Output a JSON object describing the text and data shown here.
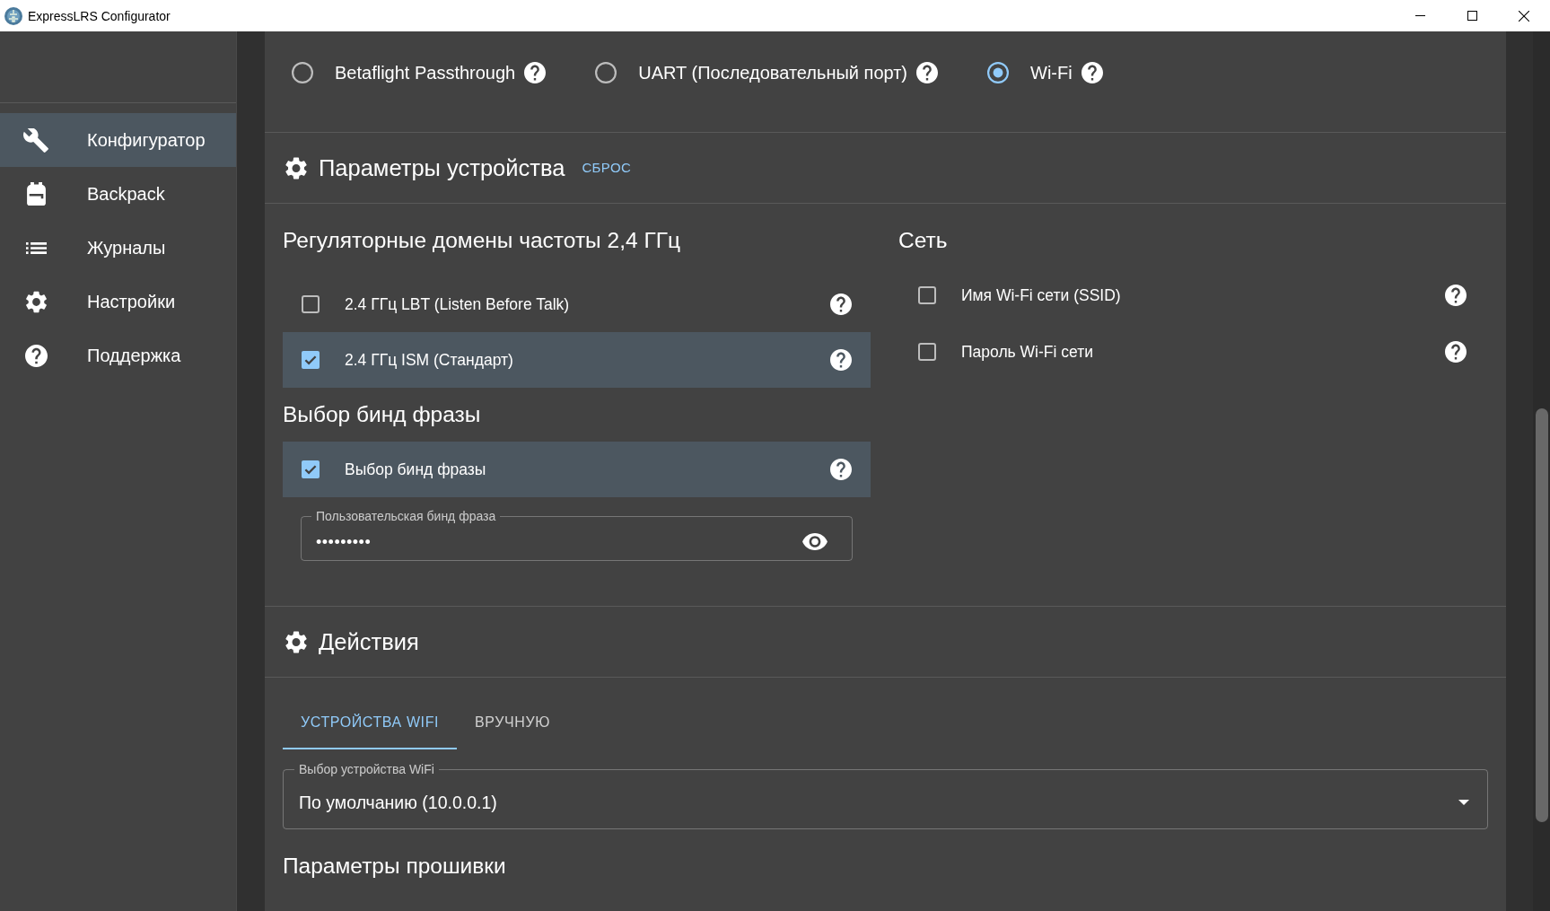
{
  "window": {
    "title": "ExpressLRS Configurator"
  },
  "sidebar": {
    "items": [
      {
        "label": "Конфигуратор",
        "selected": true
      },
      {
        "label": "Backpack",
        "selected": false
      },
      {
        "label": "Журналы",
        "selected": false
      },
      {
        "label": "Настройки",
        "selected": false
      },
      {
        "label": "Поддержка",
        "selected": false
      }
    ]
  },
  "flashing_methods": [
    {
      "label": "Betaflight Passthrough",
      "selected": false
    },
    {
      "label": "UART (Последовательный порт)",
      "selected": false
    },
    {
      "label": "Wi-Fi",
      "selected": true
    }
  ],
  "device_options": {
    "title": "Параметры устройства",
    "reset_link": "СБРОС",
    "regulatory_domains": {
      "title": "Регуляторные домены частоты 2,4 ГГц",
      "items": [
        {
          "label": "2.4 ГГц LBT (Listen Before Talk)",
          "checked": false
        },
        {
          "label": "2.4 ГГц ISM (Стандарт)",
          "checked": true
        }
      ]
    },
    "binding_phrase": {
      "title": "Выбор бинд фразы",
      "items": [
        {
          "label": "Выбор бинд фразы",
          "checked": true
        }
      ],
      "field": {
        "label": "Пользовательская бинд фраза",
        "value": "•••••••••"
      }
    },
    "network": {
      "title": "Сеть",
      "items": [
        {
          "label": "Имя Wi-Fi сети (SSID)",
          "checked": false
        },
        {
          "label": "Пароль Wi-Fi сети",
          "checked": false
        }
      ]
    }
  },
  "actions": {
    "title": "Действия",
    "tabs": [
      {
        "label": "УСТРОЙСТВА WIFI",
        "selected": true
      },
      {
        "label": "ВРУЧНУЮ",
        "selected": false
      }
    ],
    "device_select": {
      "label": "Выбор устройства WiFi",
      "value": "По умолчанию (10.0.0.1)"
    }
  },
  "firmware_options": {
    "title": "Параметры прошивки"
  }
}
